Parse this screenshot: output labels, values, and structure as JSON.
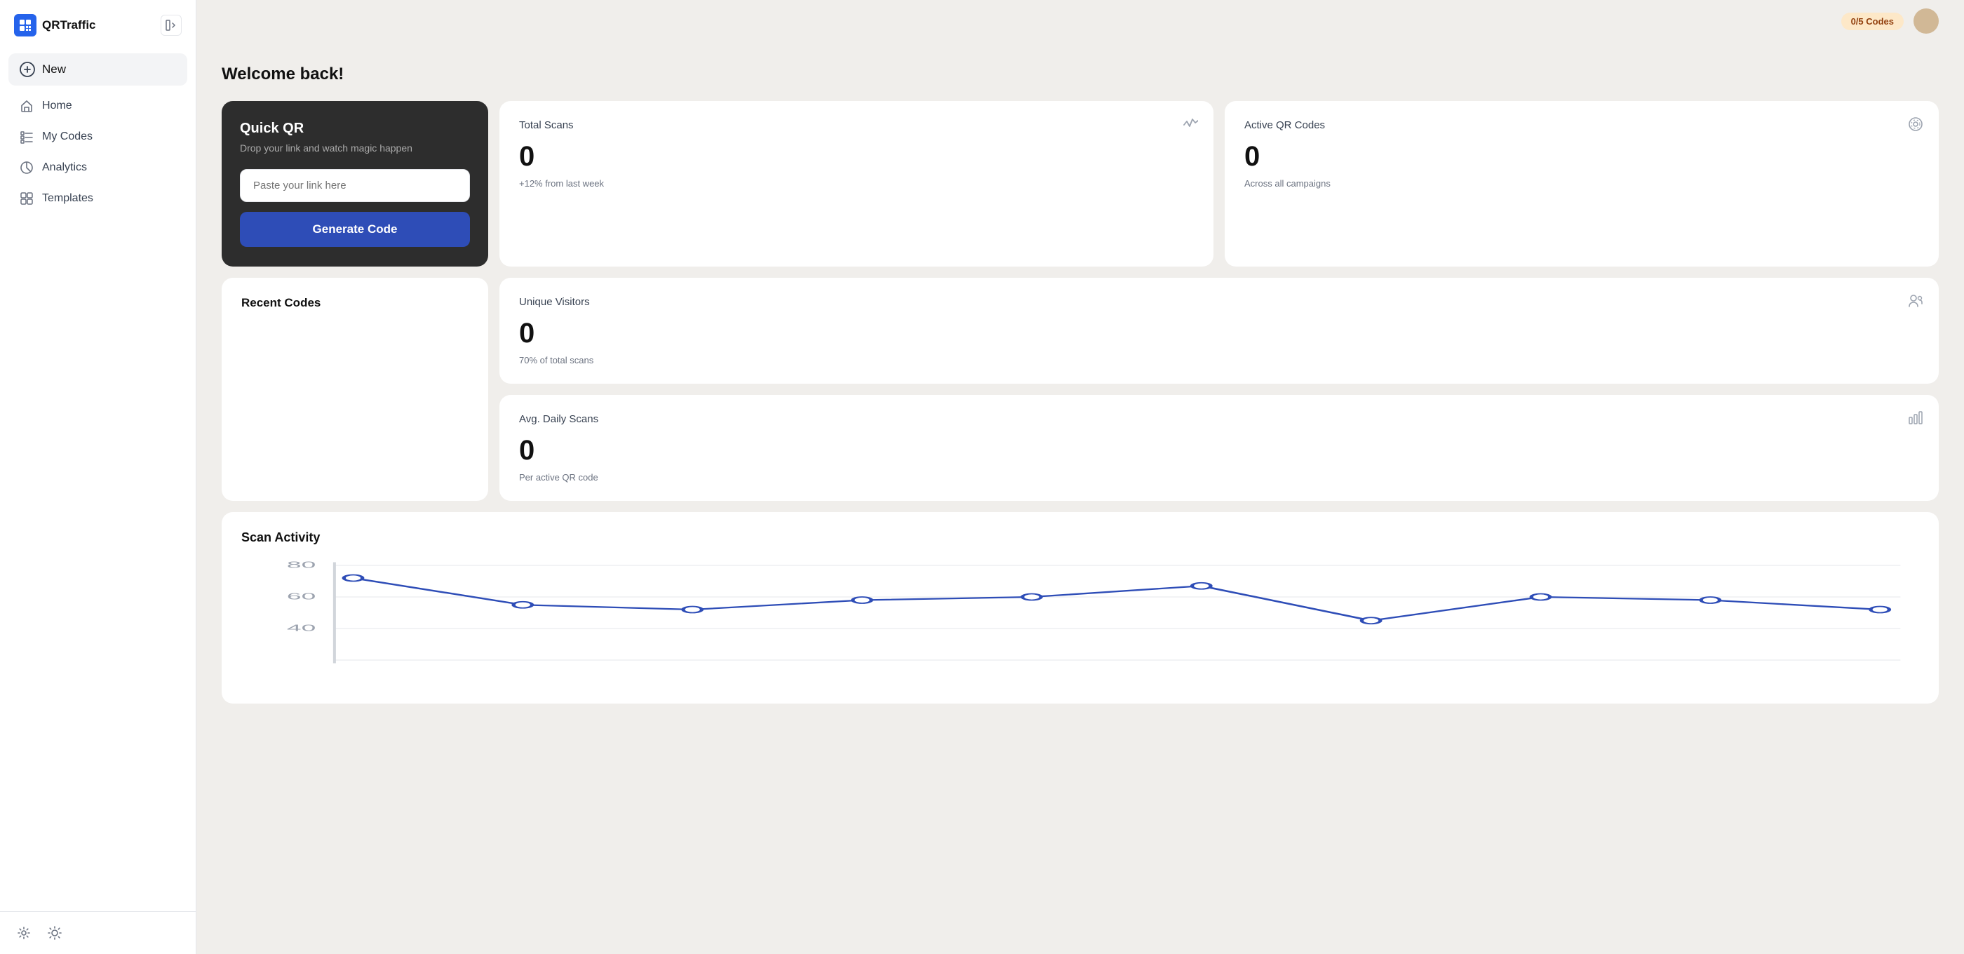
{
  "app": {
    "name": "QRTraffic",
    "codes_badge": "0/5 Codes"
  },
  "sidebar": {
    "collapse_btn_label": "collapse",
    "nav": {
      "new_label": "New",
      "items": [
        {
          "id": "home",
          "label": "Home",
          "icon": "home-icon"
        },
        {
          "id": "my-codes",
          "label": "My Codes",
          "icon": "codes-icon"
        },
        {
          "id": "analytics",
          "label": "Analytics",
          "icon": "analytics-icon"
        },
        {
          "id": "templates",
          "label": "Templates",
          "icon": "templates-icon"
        }
      ]
    },
    "footer": {
      "settings_icon": "gear-icon",
      "theme_icon": "sun-icon"
    }
  },
  "main": {
    "welcome": "Welcome back!",
    "quick_qr": {
      "title": "Quick QR",
      "subtitle": "Drop your link and watch magic happen",
      "input_placeholder": "Paste your link here",
      "button_label": "Generate Code"
    },
    "stats": [
      {
        "id": "total-scans",
        "title": "Total Scans",
        "value": "0",
        "sub": "+12% from last week",
        "icon": "activity-icon"
      },
      {
        "id": "active-qr-codes",
        "title": "Active QR Codes",
        "value": "0",
        "sub": "Across all campaigns",
        "icon": "qr-icon"
      },
      {
        "id": "unique-visitors",
        "title": "Unique Visitors",
        "value": "0",
        "sub": "70% of total scans",
        "icon": "users-icon"
      },
      {
        "id": "avg-daily-scans",
        "title": "Avg. Daily Scans",
        "value": "0",
        "sub": "Per active QR code",
        "icon": "bar-chart-icon"
      }
    ],
    "recent_codes": {
      "title": "Recent Codes"
    },
    "scan_activity": {
      "title": "Scan Activity",
      "y_labels": [
        "80",
        "60",
        "40"
      ],
      "chart_points": [
        {
          "x": 0,
          "y": 72
        },
        {
          "x": 1,
          "y": 55
        },
        {
          "x": 2,
          "y": 52
        },
        {
          "x": 3,
          "y": 58
        },
        {
          "x": 4,
          "y": 60
        },
        {
          "x": 5,
          "y": 67
        },
        {
          "x": 6,
          "y": 45
        },
        {
          "x": 7,
          "y": 60
        },
        {
          "x": 8,
          "y": 58
        },
        {
          "x": 9,
          "y": 52
        }
      ]
    }
  }
}
